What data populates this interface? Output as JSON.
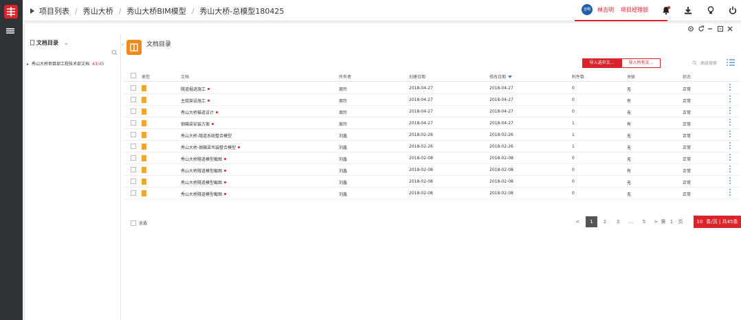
{
  "colors": {
    "accent": "#d9242b",
    "rail": "#2f3338",
    "folder_icon": "#f08a1c",
    "file_icon": "#f2a530"
  },
  "breadcrumb": [
    "项目列表",
    "秀山大桥",
    "秀山大桥BIM模型",
    "秀山大桥-总模型180425"
  ],
  "user": {
    "avatar_text": "吉明",
    "name": "林吉明",
    "role": "项目经理部"
  },
  "top_icons": [
    "bell-icon",
    "download-icon",
    "lightbulb-icon",
    "power-icon"
  ],
  "sidebar": {
    "title": "文档目录",
    "tree": [
      {
        "label": "秀山大桥项目部工程技术部文档",
        "count": "43",
        "total": "/45"
      }
    ]
  },
  "main": {
    "title": "文档目录",
    "import_current_label": "导入选中文...",
    "import_all_label": "导入所有文...",
    "search_placeholder": "高级搜索"
  },
  "table": {
    "headers": {
      "type": "类型",
      "name": "文档",
      "owner": "所有者",
      "created": "创建日期",
      "modified": "修改日期",
      "attachments": "附件数",
      "related": "关联",
      "status": "状态"
    },
    "rows": [
      {
        "name": "隧道掘进施工",
        "flag": true,
        "owner": "周玲",
        "created": "2018-04-27",
        "modified": "2018-04-27",
        "attachments": "0",
        "related": "无",
        "status": "正常"
      },
      {
        "name": "主缆架设施工",
        "flag": true,
        "owner": "周玲",
        "created": "2018-04-27",
        "modified": "2018-04-27",
        "attachments": "0",
        "related": "有",
        "status": "正常"
      },
      {
        "name": "秀山大桥猫道设计",
        "flag": true,
        "owner": "周玲",
        "created": "2018-04-27",
        "modified": "2018-04-27",
        "attachments": "0",
        "related": "无",
        "status": "正常"
      },
      {
        "name": "钢箱梁安装方案",
        "flag": true,
        "owner": "周玲",
        "created": "2018-04-27",
        "modified": "2018-04-27",
        "attachments": "1",
        "related": "有",
        "status": "正常"
      },
      {
        "name": "秀山大桥-隧道系统整合模型",
        "flag": false,
        "owner": "刘鑫",
        "created": "2018-02-26",
        "modified": "2018-02-26",
        "attachments": "1",
        "related": "无",
        "status": "正常"
      },
      {
        "name": "秀山大桥-钢箱梁吊装整合模型",
        "flag": true,
        "owner": "刘鑫",
        "created": "2018-02-26",
        "modified": "2018-02-26",
        "attachments": "1",
        "related": "无",
        "status": "正常"
      },
      {
        "name": "秀山大桥隧道模型截图",
        "flag": true,
        "owner": "刘鑫",
        "created": "2018-02-08",
        "modified": "2018-02-08",
        "attachments": "0",
        "related": "无",
        "status": "正常"
      },
      {
        "name": "秀山大桥隧道模型截图",
        "flag": true,
        "owner": "刘鑫",
        "created": "2018-02-08",
        "modified": "2018-02-08",
        "attachments": "0",
        "related": "有",
        "status": "正常"
      },
      {
        "name": "秀山大桥隧道模型截图",
        "flag": true,
        "owner": "刘鑫",
        "created": "2018-02-08",
        "modified": "2018-02-08",
        "attachments": "0",
        "related": "无",
        "status": "正常"
      },
      {
        "name": "秀山大桥隧道模型截图",
        "flag": true,
        "owner": "刘鑫",
        "created": "2018-02-08",
        "modified": "2018-02-08",
        "attachments": "0",
        "related": "无",
        "status": "正常"
      }
    ],
    "select_all": "全选"
  },
  "pager": {
    "prev": "<",
    "pages": [
      "1",
      "2",
      "3",
      "...",
      "5"
    ],
    "current": "1",
    "next": ">",
    "goto_prefix": "第",
    "goto_value": "1",
    "goto_suffix": "页",
    "page_size": "10",
    "page_size_suffix": "条/页 | 共45条"
  }
}
